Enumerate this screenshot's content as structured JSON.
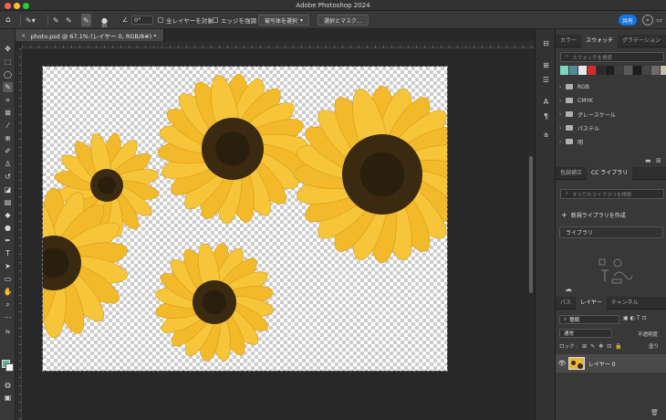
{
  "window": {
    "title": "Adobe Photoshop 2024"
  },
  "colors": {
    "accent": "#1473e6",
    "fg_swatch": "#5fb896",
    "bg_swatch": "#ffffff",
    "petal": "#f2b92a",
    "center": "#3a2a12"
  },
  "options_bar": {
    "sample_all_layers": "全レイヤーを対象",
    "enhance_edge": "エッジを強調",
    "select_subject": "被写体を選択",
    "select_and_mask": "選択とマスク...",
    "brush_size": "30",
    "angle": "0°",
    "share": "共有"
  },
  "document": {
    "tab_title": "photo.psd @ 67.1% (レイヤー 0, RGB/8#) *",
    "close_glyph": "×"
  },
  "panels": {
    "tabs_top": [
      "カラー",
      "スウォッチ",
      "グラデーション",
      "パタ"
    ],
    "active_top": "スウォッチ",
    "swatch_search_placeholder": "スウォッチを検索",
    "swatch_colors": [
      "#7fd6c0",
      "#4f8b98",
      "#e8e8e8",
      "#d22c28",
      "#2a2a2a",
      "#1e1e1e",
      "#3d3d3d",
      "#5a5a5a",
      "#1c1c1c",
      "#454545",
      "#6c6c6c",
      "#c7c0a4"
    ],
    "swatch_groups": [
      "RGB",
      "CMYK",
      "グレースケール",
      "パステル",
      "明"
    ],
    "tabs_mid": [
      "色調補正",
      "CC ライブラリ"
    ],
    "active_mid": "CC ライブラリ",
    "library_search_placeholder": "すべてのライブラリを検索",
    "create_library": "新規ライブラリを作成",
    "library_dropdown": "ライブラリ",
    "tabs_layers": [
      "パス",
      "レイヤー",
      "チャンネル"
    ],
    "active_layers": "レイヤー",
    "layer_filter": "種類",
    "blend_mode": "通常",
    "opacity_label": "不透明度",
    "lock_label": "ロック :",
    "fill_label": "塗り",
    "layer_name": "レイヤー 0"
  }
}
